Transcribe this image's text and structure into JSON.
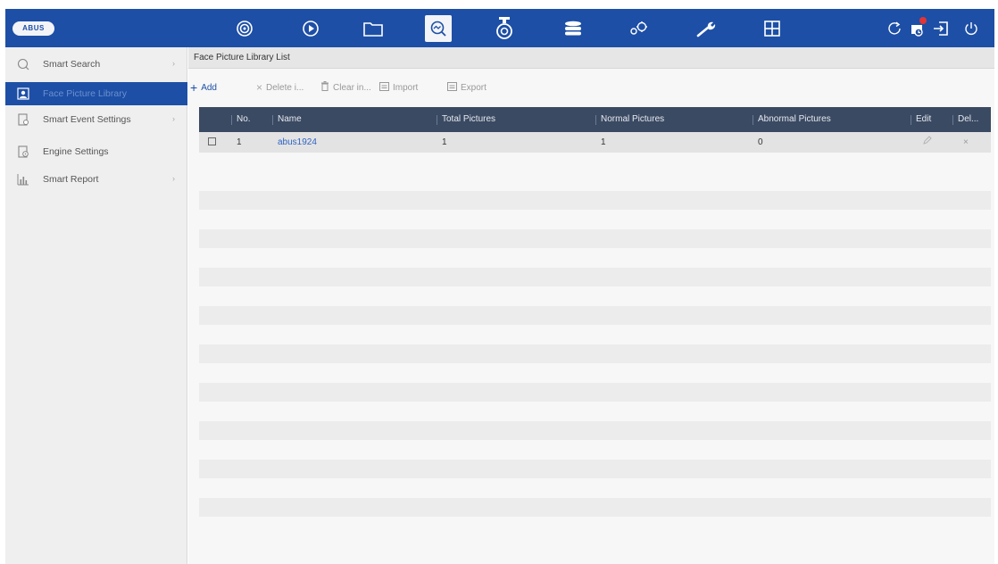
{
  "topbar": {
    "logo_text": "ABUS",
    "nav_icons": [
      "live-view-icon",
      "playback-icon",
      "files-icon",
      "smart-search-icon",
      "camera-icon",
      "storage-icon",
      "settings-icon",
      "maintenance-icon",
      "layout-grid-icon"
    ],
    "right_icons": [
      "refresh-icon",
      "alarm-icon",
      "logout-icon",
      "power-icon"
    ],
    "colors": {
      "bar": "#1d4fa6",
      "active_tile": "#f2f4f8",
      "alarm_dot": "#e23434"
    }
  },
  "sidebar": {
    "items": [
      {
        "label": "Smart Search",
        "icon": "search-circle-icon",
        "has_arrow": true
      },
      {
        "label": "Face Picture Library",
        "icon": "face-card-icon",
        "has_arrow": false,
        "active": true
      },
      {
        "label": "Smart Event Settings",
        "icon": "event-settings-icon",
        "has_arrow": true
      },
      {
        "label": "Engine Settings",
        "icon": "engine-icon",
        "has_arrow": false
      },
      {
        "label": "Smart Report",
        "icon": "bar-chart-icon",
        "has_arrow": true
      }
    ]
  },
  "main": {
    "title": "Face Picture Library List",
    "toolbar": {
      "add": "Add",
      "delete": "Delete i...",
      "clear": "Clear in...",
      "import": "Import",
      "export": "Export"
    },
    "table": {
      "headers": [
        "No.",
        "Name",
        "Total Pictures",
        "Normal Pictures",
        "Abnormal Pictures",
        "Edit",
        "Del..."
      ],
      "rows": [
        {
          "no": "1",
          "name": "abus1924",
          "total": "1",
          "normal": "1",
          "abnormal": "0"
        }
      ]
    }
  }
}
